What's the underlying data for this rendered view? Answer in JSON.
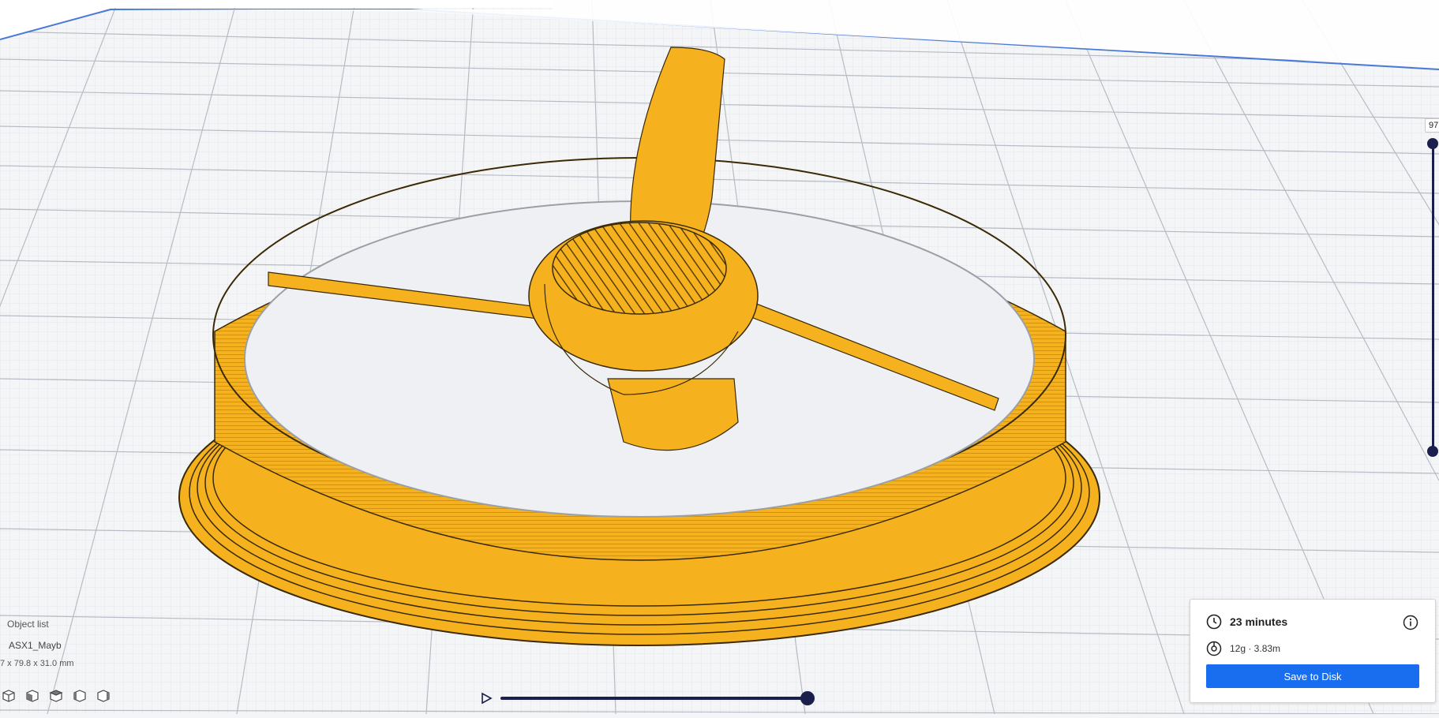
{
  "viewport": {
    "model_color": "#f5b21e",
    "model_edge_color": "#3a2a05",
    "background_color": "#f4f5f7",
    "grid_color": "#c9cdd3"
  },
  "layer_slider": {
    "current_layer_label": "97"
  },
  "object_list": {
    "title": "Object list",
    "object_name": "ASX1_Mayb",
    "dimensions": "7 x 79.8 x 31.0 mm"
  },
  "view_buttons": [
    "3d-view-icon",
    "front-view-icon",
    "top-view-icon",
    "left-view-icon",
    "right-view-icon"
  ],
  "simulation": {
    "play_icon": "play-icon",
    "progress": 1.0
  },
  "print_info": {
    "time_icon": "clock-icon",
    "print_time": "23 minutes",
    "material_icon": "spool-icon",
    "material_usage": "12g · 3.83m",
    "info_icon": "info-icon",
    "save_label": "Save to Disk",
    "accent_color": "#196ef0"
  }
}
